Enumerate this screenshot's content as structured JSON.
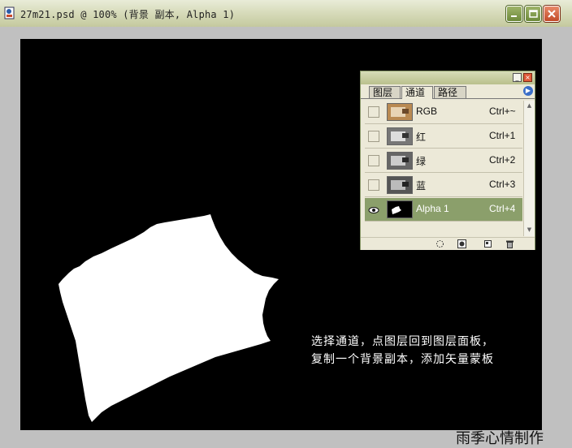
{
  "window": {
    "title": "27m21.psd @ 100% (背景 副本, Alpha 1)",
    "icon": "photoshop-document-icon"
  },
  "panel": {
    "tabs": [
      {
        "label": "图层",
        "active": false
      },
      {
        "label": "通道",
        "active": true
      },
      {
        "label": "路径",
        "active": false
      }
    ],
    "channels": [
      {
        "name": "RGB",
        "shortcut": "Ctrl+~",
        "visible": false,
        "selected": false
      },
      {
        "name": "红",
        "shortcut": "Ctrl+1",
        "visible": false,
        "selected": false
      },
      {
        "name": "绿",
        "shortcut": "Ctrl+2",
        "visible": false,
        "selected": false
      },
      {
        "name": "蓝",
        "shortcut": "Ctrl+3",
        "visible": false,
        "selected": false
      },
      {
        "name": "Alpha 1",
        "shortcut": "Ctrl+4",
        "visible": true,
        "selected": true
      }
    ],
    "bottom_icons": [
      "load-selection-icon",
      "save-selection-icon",
      "new-channel-icon",
      "delete-channel-icon"
    ]
  },
  "caption": {
    "line1": "选择通道，点图层回到图层面板，",
    "line2": "复制一个背景副本，添加矢量蒙板"
  },
  "watermark": "雨季心情制作",
  "colors": {
    "canvas": "#000000",
    "selected_row": "#8b9f6b",
    "titlebar": "#d8dcbc"
  }
}
